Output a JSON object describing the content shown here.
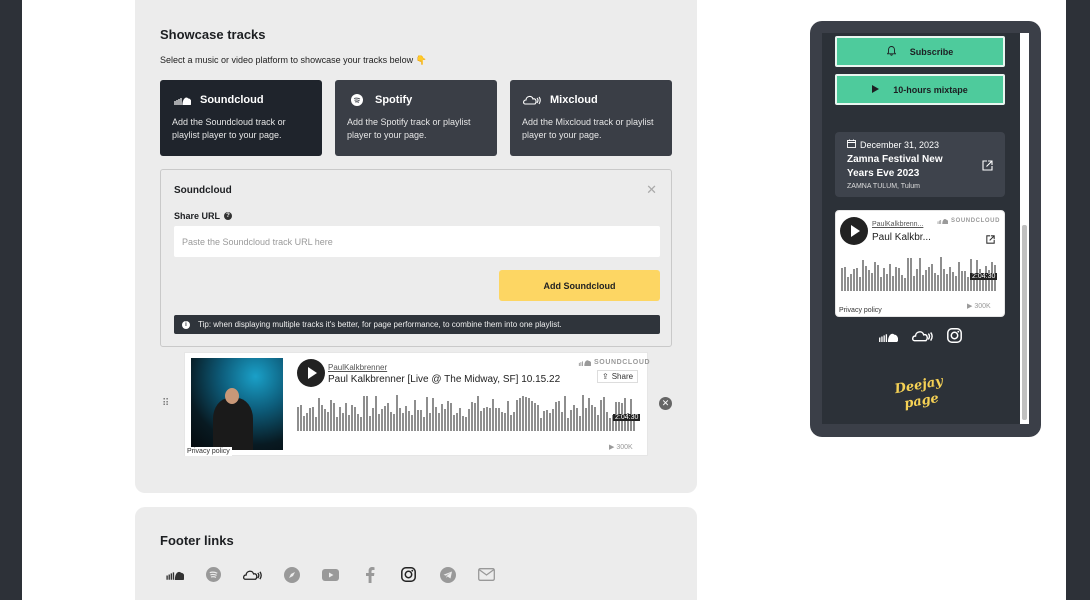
{
  "showcase": {
    "title": "Showcase tracks",
    "subtitle": "Select a music or video platform to showcase your tracks below 👇",
    "platforms": [
      {
        "name": "Soundcloud",
        "desc": "Add the Soundcloud track or playlist player to your page.",
        "icon": "soundcloud-icon"
      },
      {
        "name": "Spotify",
        "desc": "Add the Spotify track or playlist player to your page.",
        "icon": "spotify-icon"
      },
      {
        "name": "Mixcloud",
        "desc": "Add the Mixcloud track or playlist player to your page.",
        "icon": "mixcloud-icon"
      }
    ],
    "form": {
      "title": "Soundcloud",
      "share_label": "Share URL",
      "url_placeholder": "Paste the Soundcloud track URL here",
      "url_value": "",
      "add_button": "Add Soundcloud",
      "tip": "Tip: when displaying multiple tracks it's better, for page performance, to combine them into one playlist."
    },
    "embed": {
      "artist": "PaulKalkbrenner",
      "track": "Paul Kalkbrenner [Live @ The Midway, SF] 10.15.22",
      "brand": "SOUNDCLOUD",
      "share": "Share",
      "duration": "2:04:30",
      "plays": "▶ 300K",
      "privacy": "Privacy policy"
    }
  },
  "footer": {
    "title": "Footer links",
    "icons": [
      "soundcloud-icon",
      "spotify-icon",
      "mixcloud-icon",
      "compass-icon",
      "youtube-icon",
      "facebook-icon",
      "instagram-icon",
      "telegram-icon",
      "email-icon"
    ]
  },
  "phone": {
    "subscribe": "Subscribe",
    "mixtape": "10-hours mixtape",
    "event": {
      "date": "December 31, 2023",
      "title": "Zamna Festival New Years Eve 2023",
      "venue": "ZAMNA TULUM, Tulum"
    },
    "embed": {
      "artist": "PaulKalkbrenn...",
      "track": "Paul Kalkbr...",
      "brand": "SOUNDCLOUD",
      "duration": "2:04:30",
      "plays": "▶ 300K",
      "privacy": "Privacy policy"
    },
    "logo_line1": "Deejay",
    "logo_line2": "page"
  },
  "colors": {
    "accent_green": "#4ecb9c",
    "accent_yellow": "#fdd663",
    "dark": "#1f242c"
  }
}
